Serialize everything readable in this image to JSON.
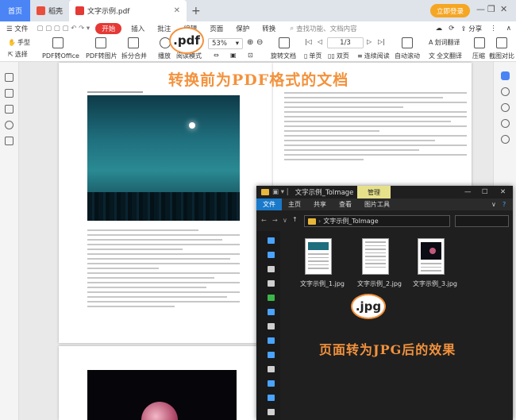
{
  "tabs": {
    "home": "首页",
    "shell": "稻壳",
    "doc": "文字示例.pdf",
    "login": "立即登录"
  },
  "menu": {
    "file": "文件",
    "start": "开始",
    "insert": "插入",
    "annotate": "批注",
    "edit": "编辑",
    "page": "页面",
    "protect": "保护",
    "convert": "转换",
    "search": "查找功能、文档内容",
    "share": "分享"
  },
  "toolbar": {
    "hand": "手型",
    "select": "选择",
    "pdf_office": "PDF转Office",
    "pdf_image": "PDF转图片",
    "split_merge": "拆分合并",
    "play": "播放",
    "read_mode": "阅读模式",
    "zoom": "53%",
    "page_indicator": "1/3",
    "rotate": "旋转文档",
    "single": "单页",
    "double": "双页",
    "continuous": "连续阅读",
    "auto_scroll": "自动滚动",
    "bg": "背景",
    "translate": "全文翻译",
    "compress": "压缩",
    "screenshot": "截图对比",
    "underline": "划词翻译"
  },
  "doc": {
    "title": "转换前为PDF格式的文档",
    "caption": "页面转为JPG后的效果"
  },
  "badges": {
    "pdf": ".pdf",
    "jpg": ".jpg"
  },
  "explorer": {
    "title": "文字示例_ToImage",
    "manage": "管理",
    "tabs": [
      "文件",
      "主页",
      "共享",
      "查看",
      "图片工具"
    ],
    "path": "文字示例_ToImage",
    "files": [
      "文字示例_1.jpg",
      "文字示例_2.jpg",
      "文字示例_3.jpg"
    ]
  },
  "colors": {
    "accent": "#4a84f5",
    "start_red": "#e53935",
    "highlight_orange": "#f3923c",
    "explorer_bg": "#1f1f1f",
    "manage_yellow": "#e7e08a"
  }
}
